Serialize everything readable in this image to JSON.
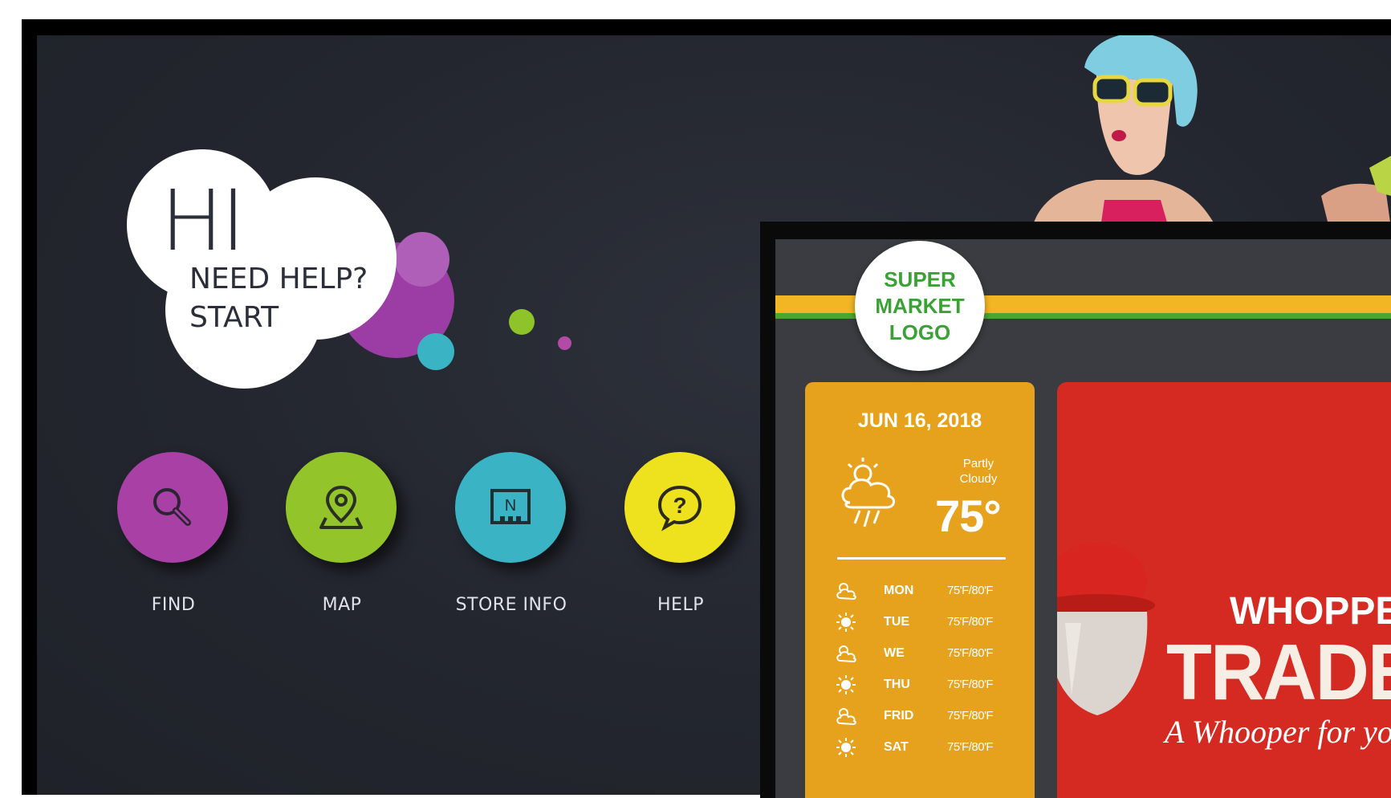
{
  "greeting": {
    "hi": "HI",
    "line1": "NEED HELP?",
    "line2": "START"
  },
  "nav": [
    {
      "label": "FIND",
      "icon": "search-icon",
      "color": "#a940a6"
    },
    {
      "label": "MAP",
      "icon": "map-pin-icon",
      "color": "#93c52a"
    },
    {
      "label": "STORE INFO",
      "icon": "store-directory-icon",
      "color": "#3ab3c4"
    },
    {
      "label": "HELP",
      "icon": "question-bubble-icon",
      "color": "#eee21e"
    }
  ],
  "signage": {
    "logo": [
      "SUPER",
      "MARKET",
      "LOGO"
    ],
    "weather": {
      "date": "JUN 16, 2018",
      "condition_line1": "Partly",
      "condition_line2": "Cloudy",
      "temp": "75°",
      "forecast": [
        {
          "day": "MON",
          "range": "75'F/80'F",
          "icon": "cloud-sun-icon"
        },
        {
          "day": "TUE",
          "range": "75'F/80'F",
          "icon": "sun-icon"
        },
        {
          "day": "WE",
          "range": "75'F/80'F",
          "icon": "cloud-sun-icon"
        },
        {
          "day": "THU",
          "range": "75'F/80'F",
          "icon": "sun-icon"
        },
        {
          "day": "FRID",
          "range": "75'F/80'F",
          "icon": "cloud-sun-icon"
        },
        {
          "day": "SAT",
          "range": "75'F/80'F",
          "icon": "sun-icon"
        }
      ]
    },
    "promo": {
      "line1": "WHOPPE",
      "line2": "TRADE-",
      "line3": "A Whooper for your"
    }
  },
  "colors": {
    "kiosk_bg": "#262930",
    "weather_bg": "#e6a21c",
    "promo_bg": "#d42a22",
    "logo_green": "#3aa235",
    "stripe_yellow": "#f2b624"
  }
}
